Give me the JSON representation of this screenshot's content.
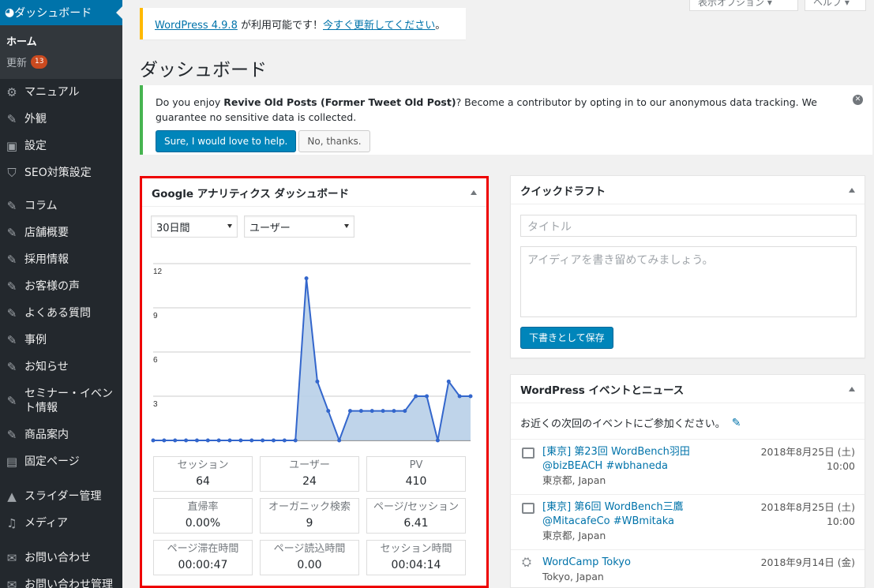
{
  "header": {
    "screen_options_label": "表示オプション ▾",
    "help_label": "ヘルプ ▾"
  },
  "sidebar": {
    "dashboard_label": "ダッシュボード",
    "home_label": "ホーム",
    "updates_label": "更新",
    "updates_count": "13",
    "items": [
      {
        "label": "マニュアル",
        "icon": "gear-icon"
      },
      {
        "label": "外観",
        "icon": "brush-icon"
      },
      {
        "label": "設定",
        "icon": "settings-icon"
      },
      {
        "label": "SEO対策設定",
        "icon": "shield-icon"
      },
      {
        "label": "コラム",
        "icon": "pin-icon"
      },
      {
        "label": "店舗概要",
        "icon": "pin-icon"
      },
      {
        "label": "採用情報",
        "icon": "pin-icon"
      },
      {
        "label": "お客様の声",
        "icon": "pin-icon"
      },
      {
        "label": "よくある質問",
        "icon": "pin-icon"
      },
      {
        "label": "事例",
        "icon": "pin-icon"
      },
      {
        "label": "お知らせ",
        "icon": "pin-icon"
      },
      {
        "label": "セミナー・イベント情報",
        "icon": "pin-icon"
      },
      {
        "label": "商品案内",
        "icon": "pin-icon"
      },
      {
        "label": "固定ページ",
        "icon": "page-icon"
      },
      {
        "label": "スライダー管理",
        "icon": "triangle-icon"
      },
      {
        "label": "メディア",
        "icon": "media-icon"
      },
      {
        "label": "お問い合わせ",
        "icon": "mail-icon"
      },
      {
        "label": "お問い合わせ管理",
        "icon": "mail-icon"
      }
    ]
  },
  "update_notice": {
    "version_link": "WordPress 4.9.8",
    "text": " が利用可能です！",
    "update_link": "今すぐ更新してください",
    "end": "。"
  },
  "page_title": "ダッシュボード",
  "plugin_notice": {
    "text_before": "Do you enjoy ",
    "plugin_name": "Revive Old Posts (Former Tweet Old Post)",
    "text_after": "? Become a contributor by opting in to our anonymous data tracking. We guarantee no sensitive data is collected.",
    "accept_label": "Sure, I would love to help.",
    "decline_label": "No, thanks."
  },
  "ga_widget": {
    "title": "Google アナリティクス ダッシュボード",
    "period_select": "30日間",
    "metric_select": "ユーザー",
    "stats": [
      {
        "label": "セッション",
        "value": "64"
      },
      {
        "label": "ユーザー",
        "value": "24"
      },
      {
        "label": "PV",
        "value": "410"
      },
      {
        "label": "直帰率",
        "value": "0.00%"
      },
      {
        "label": "オーガニック検索",
        "value": "9"
      },
      {
        "label": "ページ/セッション",
        "value": "6.41"
      },
      {
        "label": "ページ滞在時間",
        "value": "00:00:47"
      },
      {
        "label": "ページ読込時間",
        "value": "0.00"
      },
      {
        "label": "セッション時間",
        "value": "00:04:14"
      }
    ]
  },
  "chart_data": {
    "type": "area",
    "x": [
      1,
      2,
      3,
      4,
      5,
      6,
      7,
      8,
      9,
      10,
      11,
      12,
      13,
      14,
      15,
      16,
      17,
      18,
      19,
      20,
      21,
      22,
      23,
      24,
      25,
      26,
      27,
      28,
      29,
      30
    ],
    "values": [
      0,
      0,
      0,
      0,
      0,
      0,
      0,
      0,
      0,
      0,
      0,
      0,
      0,
      0,
      11,
      4,
      2,
      0,
      2,
      2,
      2,
      2,
      2,
      2,
      3,
      3,
      0,
      4,
      3,
      3
    ],
    "yticks": [
      3,
      6,
      9,
      12
    ],
    "ylim": [
      0,
      12
    ],
    "color": "#3366cc",
    "fill": "#b8cfe8"
  },
  "quick_draft": {
    "title": "クイックドラフト",
    "title_placeholder": "タイトル",
    "content_placeholder": "アイディアを書き留めてみましょう。",
    "save_label": "下書きとして保存"
  },
  "events": {
    "title": "WordPress イベントとニュース",
    "intro": "お近くの次回のイベントにご参加ください。",
    "items": [
      {
        "title": "[東京] 第23回 WordBench羽田",
        "subtitle": "@bizBEACH #wbhaneda",
        "location": "東京都, Japan",
        "date": "2018年8月25日 (土)",
        "time": "10:00"
      },
      {
        "title": "[東京] 第6回 WordBench三鷹",
        "subtitle": "@MitacafeCo #WBmitaka",
        "location": "東京都, Japan",
        "date": "2018年8月25日 (土)",
        "time": "10:00"
      },
      {
        "title": "WordCamp Tokyo",
        "subtitle": "",
        "location": "Tokyo, Japan",
        "date": "2018年9月14日 (金)",
        "time": ""
      }
    ]
  }
}
